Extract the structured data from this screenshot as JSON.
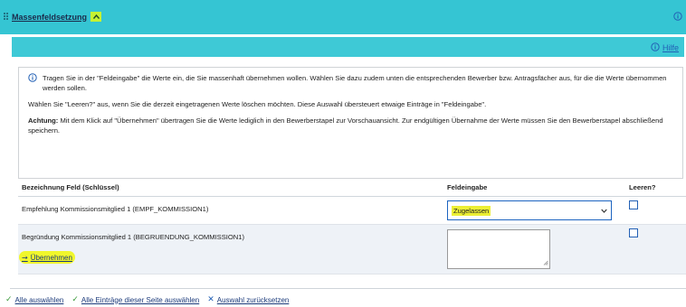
{
  "panel": {
    "title": "Massenfeldsetzung",
    "collapse_icon": "chevron-up-icon",
    "info_icon": "info-icon",
    "accent_color": "#35c5d3"
  },
  "help": {
    "label": "Hilfe",
    "icon": "info-icon"
  },
  "info": {
    "line1": "Tragen Sie in der \"Feldeingabe\" die Werte ein, die Sie massenhaft übernehmen wollen. Wählen Sie dazu zudem unten die entsprechenden Bewerber bzw. Antragsfächer aus, für die die Werte übernommen werden sollen.",
    "line2": "Wählen Sie \"Leeren?\" aus, wenn Sie die derzeit eingetragenen Werte löschen möchten. Diese Auswahl übersteuert etwaige Einträge in \"Feldeingabe\".",
    "line3_bold": "Achtung:",
    "line3_rest": " Mit dem Klick auf \"Übernehmen\" übertragen Sie die Werte lediglich in den Bewerberstapel zur Vorschauansicht. Zur endgültigen Übernahme der Werte müssen Sie den Bewerberstapel abschließend speichern."
  },
  "table": {
    "headers": [
      "Bezeichnung Feld (Schlüssel)",
      "Feldeingabe",
      "Leeren?"
    ],
    "rows": [
      {
        "label": "Empfehlung Kommissionsmitglied 1 (EMPF_KOMMISSION1)",
        "select_value": "Zugelassen",
        "clear_checked": false
      },
      {
        "label": "Begründung Kommissionsmitglied 1 (BEGRUENDUNG_KOMMISSION1)",
        "textarea_value": "",
        "clear_checked": false
      }
    ]
  },
  "apply": {
    "label": "Übernehmen",
    "icon": "arrow-right-icon"
  },
  "footer": {
    "select_all": "Alle auswählen",
    "select_page": "Alle Einträge dieser Seite auswählen",
    "reset": "Auswahl zurücksetzen"
  }
}
